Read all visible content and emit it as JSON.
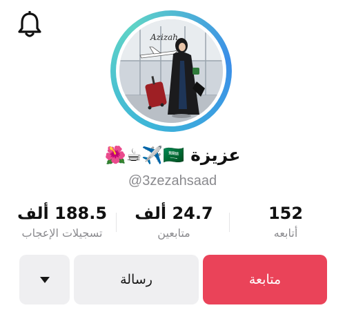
{
  "header": {
    "notifications_icon": "bell-icon"
  },
  "profile": {
    "avatar_icon": "profile-photo",
    "avatar_watermark": "Azizah",
    "display_name": "عزيزة",
    "name_emojis": [
      "🇸🇦",
      "✈️",
      "☕",
      "🌺"
    ],
    "username": "@3zezahsaad",
    "ring_colors": [
      "#3db5d8",
      "#5fd3c6",
      "#3a8de8"
    ]
  },
  "stats": {
    "following": {
      "value": "152",
      "label": "أتابعه"
    },
    "followers": {
      "value": "24.7 ألف",
      "label": "متابعين"
    },
    "likes": {
      "value": "188.5 ألف",
      "label": "تسجيلات الإعجاب"
    }
  },
  "actions": {
    "follow_label": "متابعة",
    "message_label": "رسالة",
    "more_icon": "caret-down-icon"
  },
  "colors": {
    "follow_button": "#ea4359",
    "secondary_button": "#efeff1",
    "muted_text": "#8a8a8e"
  }
}
